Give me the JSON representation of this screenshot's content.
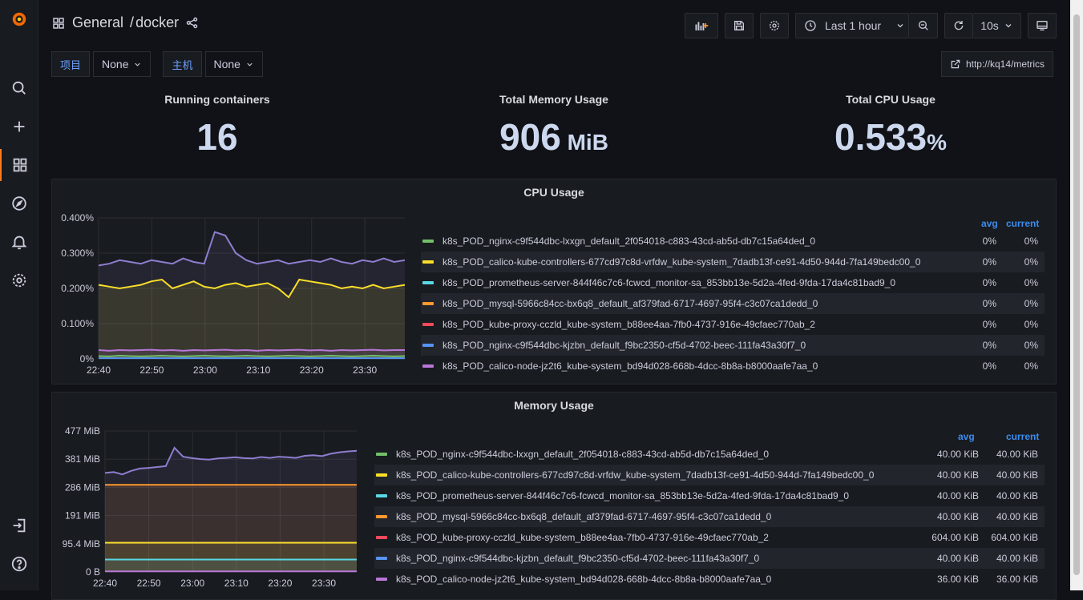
{
  "nav": {
    "folder": "General",
    "separator": "/",
    "dashboard": "docker"
  },
  "toolbar": {
    "time_range": "Last 1 hour",
    "refresh_interval": "10s"
  },
  "variables": [
    {
      "label": "项目",
      "value": "None"
    },
    {
      "label": "主机",
      "value": "None"
    }
  ],
  "link": {
    "label": "http://kq14/metrics"
  },
  "stats": [
    {
      "title": "Running containers",
      "value": "16",
      "unit": ""
    },
    {
      "title": "Total Memory Usage",
      "value": "906",
      "unit": " MiB"
    },
    {
      "title": "Total CPU Usage",
      "value": "0.533",
      "unit": "%"
    }
  ],
  "colors": {
    "green": "#73bf69",
    "yellow": "#fade2a",
    "cyan": "#5ad8e6",
    "orange": "#ff9830",
    "red": "#f2495c",
    "blue": "#5794f2",
    "purple": "#b877d9",
    "lavender": "#8f7dd0"
  },
  "cpu_panel": {
    "title": "CPU Usage",
    "avg_label": "avg",
    "current_label": "current",
    "series": [
      {
        "name": "k8s_POD_nginx-c9f544dbc-lxxgn_default_2f054018-c883-43cd-ab5d-db7c15a64ded_0",
        "avg": "0%",
        "current": "0%",
        "color": "#73bf69"
      },
      {
        "name": "k8s_POD_calico-kube-controllers-677cd97c8d-vrfdw_kube-system_7dadb13f-ce91-4d50-944d-7fa149bedc00_0",
        "avg": "0%",
        "current": "0%",
        "color": "#fade2a"
      },
      {
        "name": "k8s_POD_prometheus-server-844f46c7c6-fcwcd_monitor-sa_853bb13e-5d2a-4fed-9fda-17da4c81bad9_0",
        "avg": "0%",
        "current": "0%",
        "color": "#5ad8e6"
      },
      {
        "name": "k8s_POD_mysql-5966c84cc-bx6q8_default_af379fad-6717-4697-95f4-c3c07ca1dedd_0",
        "avg": "0%",
        "current": "0%",
        "color": "#ff9830"
      },
      {
        "name": "k8s_POD_kube-proxy-cczld_kube-system_b88ee4aa-7fb0-4737-916e-49cfaec770ab_2",
        "avg": "0%",
        "current": "0%",
        "color": "#f2495c"
      },
      {
        "name": "k8s_POD_nginx-c9f544dbc-kjzbn_default_f9bc2350-cf5d-4702-beec-111fa43a30f7_0",
        "avg": "0%",
        "current": "0%",
        "color": "#5794f2"
      },
      {
        "name": "k8s_POD_calico-node-jz2t6_kube-system_bd94d028-668b-4dcc-8b8a-b8000aafe7aa_0",
        "avg": "0%",
        "current": "0%",
        "color": "#b877d9"
      }
    ]
  },
  "mem_panel": {
    "title": "Memory Usage",
    "avg_label": "avg",
    "current_label": "current",
    "series": [
      {
        "name": "k8s_POD_nginx-c9f544dbc-lxxgn_default_2f054018-c883-43cd-ab5d-db7c15a64ded_0",
        "avg": "40.00 KiB",
        "current": "40.00 KiB",
        "color": "#73bf69"
      },
      {
        "name": "k8s_POD_calico-kube-controllers-677cd97c8d-vrfdw_kube-system_7dadb13f-ce91-4d50-944d-7fa149bedc00_0",
        "avg": "40.00 KiB",
        "current": "40.00 KiB",
        "color": "#fade2a"
      },
      {
        "name": "k8s_POD_prometheus-server-844f46c7c6-fcwcd_monitor-sa_853bb13e-5d2a-4fed-9fda-17da4c81bad9_0",
        "avg": "40.00 KiB",
        "current": "40.00 KiB",
        "color": "#5ad8e6"
      },
      {
        "name": "k8s_POD_mysql-5966c84cc-bx6q8_default_af379fad-6717-4697-95f4-c3c07ca1dedd_0",
        "avg": "40.00 KiB",
        "current": "40.00 KiB",
        "color": "#ff9830"
      },
      {
        "name": "k8s_POD_kube-proxy-cczld_kube-system_b88ee4aa-7fb0-4737-916e-49cfaec770ab_2",
        "avg": "604.00 KiB",
        "current": "604.00 KiB",
        "color": "#f2495c"
      },
      {
        "name": "k8s_POD_nginx-c9f544dbc-kjzbn_default_f9bc2350-cf5d-4702-beec-111fa43a30f7_0",
        "avg": "40.00 KiB",
        "current": "40.00 KiB",
        "color": "#5794f2"
      },
      {
        "name": "k8s_POD_calico-node-jz2t6_kube-system_bd94d028-668b-4dcc-8b8a-b8000aafe7aa_0",
        "avg": "36.00 KiB",
        "current": "36.00 KiB",
        "color": "#b877d9"
      }
    ]
  },
  "chart_data": [
    {
      "type": "area",
      "title": "CPU Usage",
      "x_ticks": [
        "22:40",
        "22:50",
        "23:00",
        "23:10",
        "23:20",
        "23:30"
      ],
      "y_ticks": [
        "0%",
        "0.100%",
        "0.200%",
        "0.300%",
        "0.400%"
      ],
      "ylim": [
        0,
        0.4
      ],
      "series": [
        {
          "color": "#8f7dd0",
          "values": [
            0.265,
            0.27,
            0.28,
            0.275,
            0.27,
            0.28,
            0.275,
            0.27,
            0.285,
            0.275,
            0.27,
            0.36,
            0.35,
            0.3,
            0.28,
            0.27,
            0.275,
            0.28,
            0.27,
            0.275,
            0.28,
            0.275,
            0.285,
            0.275,
            0.27,
            0.28,
            0.275,
            0.285,
            0.275,
            0.28
          ]
        },
        {
          "color": "#fade2a",
          "values": [
            0.21,
            0.205,
            0.2,
            0.205,
            0.21,
            0.22,
            0.225,
            0.2,
            0.21,
            0.22,
            0.205,
            0.2,
            0.21,
            0.215,
            0.205,
            0.21,
            0.215,
            0.2,
            0.175,
            0.225,
            0.22,
            0.215,
            0.21,
            0.2,
            0.205,
            0.2,
            0.21,
            0.2,
            0.205,
            0.21
          ]
        },
        {
          "color": "#b877d9",
          "values": [
            0.025,
            0.023,
            0.025,
            0.024,
            0.025,
            0.026,
            0.024,
            0.025,
            0.023,
            0.025,
            0.024,
            0.025,
            0.026,
            0.024,
            0.025,
            0.023,
            0.025,
            0.024,
            0.025,
            0.026,
            0.024,
            0.025,
            0.023,
            0.025,
            0.024,
            0.025,
            0.026,
            0.024,
            0.025,
            0.025
          ]
        },
        {
          "color": "#73bf69",
          "values": [
            0.008,
            0.007,
            0.009,
            0.008,
            0.007,
            0.008,
            0.009,
            0.008,
            0.007,
            0.008,
            0.009,
            0.008,
            0.007,
            0.008,
            0.009,
            0.008,
            0.007,
            0.008,
            0.009,
            0.008,
            0.007,
            0.008,
            0.009,
            0.008,
            0.007,
            0.008,
            0.009,
            0.008,
            0.007,
            0.008
          ]
        },
        {
          "color": "#5794f2",
          "values": [
            0.002,
            0.002,
            0.002,
            0.002,
            0.002,
            0.002,
            0.002,
            0.002,
            0.002,
            0.002,
            0.002,
            0.002,
            0.002,
            0.002,
            0.002,
            0.002,
            0.002,
            0.002,
            0.002,
            0.002,
            0.002,
            0.002,
            0.002,
            0.002,
            0.002,
            0.002,
            0.002,
            0.002,
            0.002,
            0.002
          ]
        }
      ]
    },
    {
      "type": "area",
      "title": "Memory Usage",
      "x_ticks": [
        "22:40",
        "22:50",
        "23:00",
        "23:10",
        "23:20",
        "23:30"
      ],
      "y_ticks": [
        "0 B",
        "95.4 MiB",
        "191 MiB",
        "286 MiB",
        "381 MiB",
        "477 MiB"
      ],
      "ylim": [
        0,
        477
      ],
      "series": [
        {
          "color": "#8f7dd0",
          "values": [
            335,
            338,
            330,
            342,
            350,
            352,
            355,
            358,
            420,
            390,
            385,
            382,
            380,
            384,
            386,
            388,
            385,
            384,
            389,
            386,
            390,
            388,
            386,
            393,
            395,
            392,
            400,
            405,
            408,
            410
          ]
        },
        {
          "color": "#ff9830",
          "values": [
            295,
            295,
            295,
            295,
            295,
            295,
            295,
            295,
            295,
            295,
            295,
            295,
            295,
            295,
            295,
            295,
            295,
            295,
            295,
            295,
            295,
            295,
            295,
            295,
            295,
            295,
            295,
            295,
            295,
            295
          ]
        },
        {
          "color": "#fade2a",
          "values": [
            99,
            99,
            99,
            99,
            99,
            99,
            99,
            99,
            99,
            99,
            99,
            99,
            99,
            99,
            99,
            99,
            99,
            99,
            99,
            99,
            99,
            99,
            99,
            99,
            99,
            99,
            99,
            99,
            99,
            99
          ]
        },
        {
          "color": "#5ad8e6",
          "values": [
            42,
            42,
            42,
            42,
            42,
            42,
            42,
            42,
            42,
            42,
            42,
            42,
            42,
            42,
            42,
            42,
            42,
            42,
            42,
            42,
            42,
            42,
            42,
            42,
            42,
            42,
            42,
            42,
            42,
            42
          ]
        },
        {
          "color": "#b877d9",
          "values": [
            2,
            2,
            2,
            2,
            2,
            2,
            2,
            2,
            2,
            2,
            2,
            2,
            2,
            2,
            2,
            2,
            2,
            2,
            2,
            2,
            2,
            2,
            2,
            2,
            2,
            2,
            2,
            2,
            2,
            2
          ]
        }
      ]
    }
  ]
}
